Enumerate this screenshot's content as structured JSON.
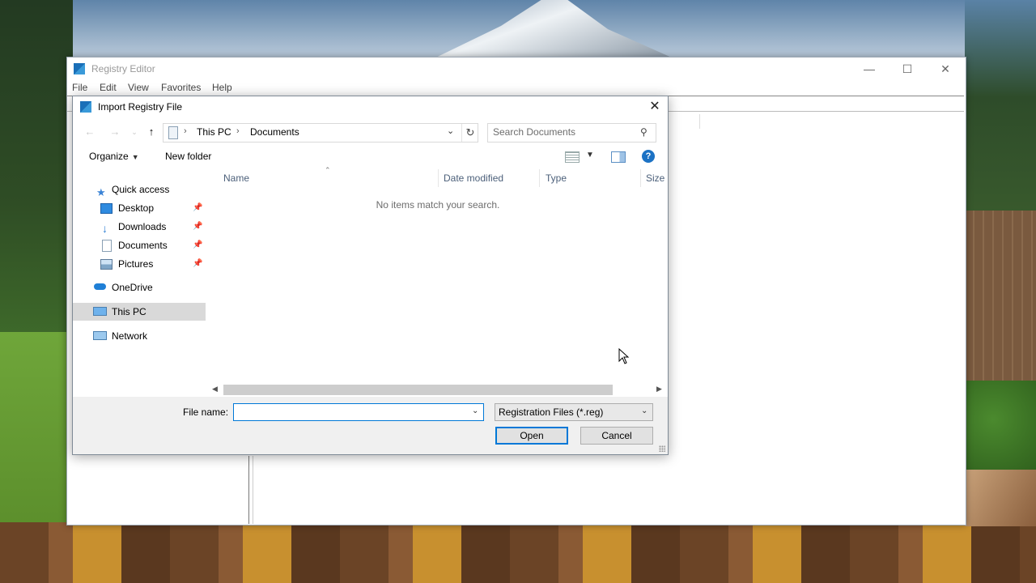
{
  "registry_editor": {
    "title": "Registry Editor",
    "menu": [
      "File",
      "Edit",
      "View",
      "Favorites",
      "Help"
    ]
  },
  "dialog": {
    "title": "Import Registry File",
    "breadcrumb": [
      "This PC",
      "Documents"
    ],
    "search_placeholder": "Search Documents",
    "toolbar": {
      "organize": "Organize",
      "new_folder": "New folder"
    },
    "nav": {
      "quick_access": "Quick access",
      "desktop": "Desktop",
      "downloads": "Downloads",
      "documents": "Documents",
      "pictures": "Pictures",
      "onedrive": "OneDrive",
      "this_pc": "This PC",
      "network": "Network"
    },
    "columns": {
      "name": "Name",
      "date_modified": "Date modified",
      "type": "Type",
      "size": "Size"
    },
    "empty_message": "No items match your search.",
    "file_name_label": "File name:",
    "file_name_value": "",
    "file_type_filter": "Registration Files (*.reg)",
    "open_label": "Open",
    "cancel_label": "Cancel"
  },
  "icons": {
    "quick_access": "star-icon",
    "desktop": "desktop-icon",
    "downloads": "download-arrow-icon",
    "documents": "document-icon",
    "pictures": "picture-icon",
    "onedrive": "cloud-icon",
    "this_pc": "computer-icon",
    "network": "network-icon"
  },
  "colors": {
    "accent": "#0078d7",
    "selected_nav": "#d9d9d9",
    "help": "#1c72c4"
  }
}
